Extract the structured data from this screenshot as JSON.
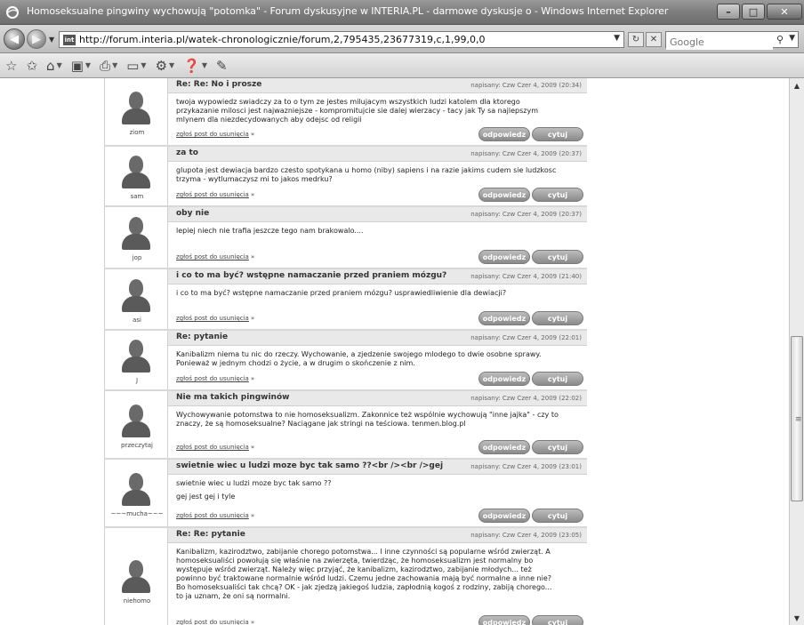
{
  "window": {
    "title": "Homoseksualne pingwiny wychowują \"potomka\" - Forum dyskusyjne w INTERIA.PL - darmowe dyskusje o - Windows Internet Explorer",
    "controls": {
      "minimize": "–",
      "maximize": "□",
      "close": "✕"
    }
  },
  "address_bar": {
    "url": "http://forum.interia.pl/watek-chronologicznie/forum,2,795435,23677319,c,1,99,0,0",
    "search_placeholder": "Google"
  },
  "command_bar": {
    "icons": [
      "favorites-star-icon",
      "add-favorites-icon",
      "home-icon",
      "feeds-icon",
      "print-icon",
      "page-icon",
      "tools-icon",
      "help-icon",
      "research-icon"
    ]
  },
  "report_label": "zgłoś post do usunięcia",
  "reply_label": "odpowiedz",
  "quote_label": "cytuj",
  "posts": [
    {
      "username": "ziom",
      "subject": "Re: Re: No i prosze",
      "date": "napisany: Czw Czer 4, 2009 (20:34)",
      "lines": [
        "twoja wypowiedz swiadczy za to o tym ze jestes milujacym wszystkich ludzi katolem dla ktorego przykazanie milosci jest najwazniejsze - kompromitujcie sie dalej wierzacy - tacy jak Ty sa najlepszym mlynem dla niezdecydowanych aby odejsc od religii"
      ]
    },
    {
      "username": "sam",
      "subject": "za to",
      "date": "napisany: Czw Czer 4, 2009 (20:37)",
      "lines": [
        "glupota jest dewiacja bardzo czesto spotykana u homo (niby) sapiens i na razie jakims cudem sie ludzkosc trzyma - wytlumaczysz mi to jakos medrku?"
      ]
    },
    {
      "username": "jop",
      "subject": "oby nie",
      "date": "napisany: Czw Czer 4, 2009 (20:37)",
      "lines": [
        "lepiej niech nie trafia jeszcze tego nam brakowalo...."
      ]
    },
    {
      "username": "asi",
      "subject": "i co to ma być? wstępne namaczanie przed praniem mózgu?",
      "date": "napisany: Czw Czer 4, 2009 (21:40)",
      "lines": [
        "i co to ma być? wstępne namaczanie przed praniem mózgu? usprawiedliwienie dla dewiacji?"
      ]
    },
    {
      "username": "J",
      "subject": "Re: pytanie",
      "date": "napisany: Czw Czer 4, 2009 (22:01)",
      "lines": [
        "Kanibalizm niema tu nic do rzeczy. Wychowanie, a zjedzenie swojego mlodego to dwie osobne sprawy. Ponieważ w jednym chodzi o życie, a w drugim o skończenie z nim."
      ]
    },
    {
      "username": "przeczytaj",
      "subject": "Nie ma takich pingwinów",
      "date": "napisany: Czw Czer 4, 2009 (22:02)",
      "lines": [
        "Wychowywanie potomstwa to nie homoseksualizm. Zakonnice też wspólnie wychowują \"inne jajka\" - czy to znaczy, że są homoseksualne? Naciągane jak stringi na teściowa. tenmen.blog.pl"
      ]
    },
    {
      "username": "~~~mucha~~~",
      "subject": "swietnie wiec u ludzi moze byc tak samo ??<br /><br />gej",
      "date": "napisany: Czw Czer 4, 2009 (23:01)",
      "lines": [
        "swietnie wiec u ludzi moze byc tak samo ??",
        "gej jest gej i tyle"
      ]
    },
    {
      "username": "niehomo",
      "subject": "Re: Re: pytanie",
      "date": "napisany: Czw Czer 4, 2009 (23:05)",
      "lines": [
        "Kanibalizm, kazirodztwo, zabijanie chorego potomstwa... I inne czynności są popularne wśród zwierząt. A homoseksualiści powołują się właśnie na zwierzęta, twierdząc, że homoseksualizm jest normalny bo występuje wśród zwierząt. Należy więc przyjąć, że kanibalizm, kazirodztwo, zabijanie młodych... też powinno być traktowane normalnie wśród ludzi. Czemu jedne zachowania mają być normalne a inne nie? Bo homoseksualiści tak chcą? OK - jak zjedzą jakiegoś ludzia, zapłodnią kogoś z rodziny, zabiją chorego... to ja uznam, że oni są normalni."
      ]
    }
  ]
}
